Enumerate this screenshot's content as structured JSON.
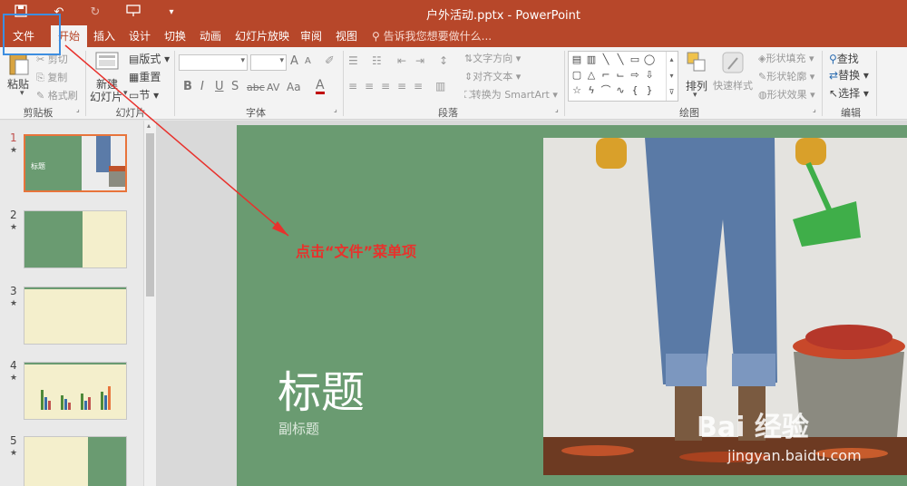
{
  "window": {
    "title": "户外活动.pptx - PowerPoint"
  },
  "quick_access": {
    "save_icon": "save-icon",
    "undo_icon": "undo-icon",
    "redo_icon": "redo-icon",
    "present_icon": "present-icon",
    "customize_icon": "customize-icon"
  },
  "tabs": [
    {
      "label": "文件"
    },
    {
      "label": "开始"
    },
    {
      "label": "插入"
    },
    {
      "label": "设计"
    },
    {
      "label": "切换"
    },
    {
      "label": "动画"
    },
    {
      "label": "幻灯片放映"
    },
    {
      "label": "审阅"
    },
    {
      "label": "视图"
    }
  ],
  "tell_me": "告诉我您想要做什么...",
  "ribbon": {
    "clipboard": {
      "paste": "粘贴",
      "cut": "剪切",
      "copy": "复制",
      "format_painter": "格式刷",
      "label": "剪贴板"
    },
    "slides": {
      "new_slide_line1": "新建",
      "new_slide_line2": "幻灯片",
      "layout": "版式",
      "reset": "重置",
      "section": "节",
      "label": "幻灯片"
    },
    "font": {
      "label": "字体",
      "bold": "B",
      "italic": "I",
      "underline": "U",
      "strike": "S",
      "abc": "abc",
      "av": "AV",
      "aa": "Aa",
      "a_color": "A",
      "grow": "A",
      "shrink": "A"
    },
    "paragraph": {
      "text_direction": "文字方向",
      "align_text": "对齐文本",
      "smartart": "转换为 SmartArt",
      "label": "段落"
    },
    "drawing": {
      "arrange": "排列",
      "quick_styles": "快速样式",
      "shape_fill": "形状填充",
      "shape_outline": "形状轮廓",
      "shape_effects": "形状效果",
      "label": "绘图"
    },
    "editing": {
      "find": "查找",
      "replace": "替换",
      "select": "选择",
      "label": "编辑"
    }
  },
  "thumbnails": [
    {
      "num": "1",
      "star": "★",
      "mini_title": "标题"
    },
    {
      "num": "2",
      "star": "★"
    },
    {
      "num": "3",
      "star": "★"
    },
    {
      "num": "4",
      "star": "★"
    },
    {
      "num": "5",
      "star": "★"
    }
  ],
  "slide": {
    "title": "标题",
    "subtitle": "副标题"
  },
  "annotation": "点击“文件”菜单项",
  "watermark": {
    "logo": "Bai 经验",
    "url": "jingyan.baidu.com"
  },
  "colors": {
    "accent": "#b7472a",
    "slide_green": "#6a9b71",
    "annotation_red": "#e8312c",
    "highlight_blue": "#3d8ee0"
  }
}
